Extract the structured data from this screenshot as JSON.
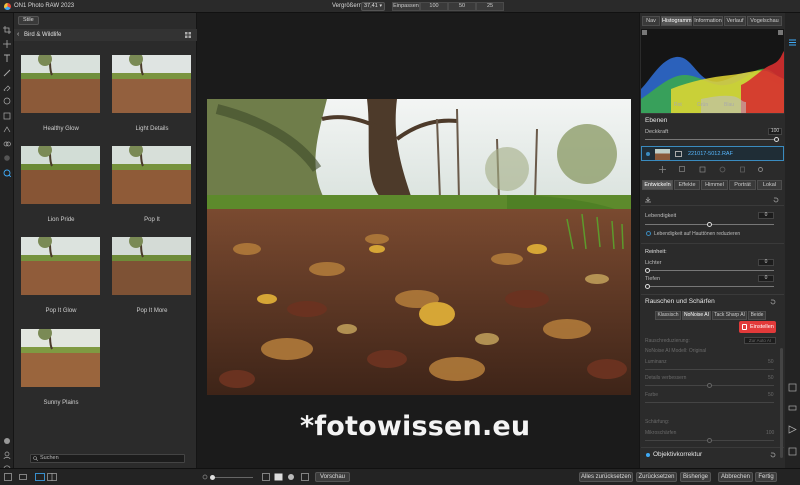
{
  "app": {
    "title": "ON1 Photo RAW 2023"
  },
  "toolbar": {
    "zoom_label": "Vergrößern",
    "zoom_value": "37,41",
    "fit_label": "Einpassen",
    "zoom_100": "100",
    "zoom_50": "50",
    "zoom_25": "25"
  },
  "presets": {
    "tab_label": "Stile",
    "category": "Bird & Wildlife",
    "items": [
      {
        "label": "Healthy Glow"
      },
      {
        "label": "Light Details"
      },
      {
        "label": "Lion Pride"
      },
      {
        "label": "Pop It"
      },
      {
        "label": "Pop It Glow"
      },
      {
        "label": "Pop It More"
      },
      {
        "label": "Sunny Plains"
      }
    ],
    "search_placeholder": "Suchen"
  },
  "canvas": {
    "watermark": "*fotowissen.eu"
  },
  "right_panel": {
    "tabs": [
      "Nav",
      "Histogramm",
      "Information",
      "Verlauf",
      "Vogelschau"
    ],
    "active_tab": "Histogramm",
    "histogram_legend": {
      "red": "Rot",
      "green": "Grün",
      "blue": "Blau"
    },
    "layers_title": "Ebenen",
    "opacity_label": "Deckkraft",
    "opacity_value": "100",
    "layer_name": "221017-5012.RAF",
    "modules": [
      "Entwickeln",
      "Effekte",
      "Himmel",
      "Porträt",
      "Lokal"
    ],
    "active_module": "Entwickeln",
    "vibrance_label": "Lebendigkeit",
    "vibrance_value": "0",
    "skin_tone_label": "Lebendigkeit auf Hauttönen reduzieren",
    "purity_title": "Reinheit:",
    "lights_label": "Lichter",
    "lights_value": "0",
    "depths_label": "Tiefen",
    "depths_value": "0",
    "noise_title": "Rauschen und Schärfen",
    "noise_tabs": [
      "Klassisch",
      "NoNoise AI",
      "Tack Sharp AI",
      "Beide"
    ],
    "active_noise_tab": "NoNoise AI",
    "unlock_button": "Einstellen",
    "noise_reduction_label": "Rauschreduzierung:",
    "auto_label": "Zur Auto AI",
    "nonoise_mode": "NoNoise AI Modell: Original",
    "luminance_label": "Luminanz",
    "luminance_value": "50",
    "detail_label": "Details verbessern",
    "detail_value": "50",
    "color_label": "Farbe",
    "color_value": "50",
    "sharpen_label": "Schärfung:",
    "microsharpen_label": "Mikroschärfen",
    "microsharpen_value": "100",
    "lens_title": "Objektivkorrektur"
  },
  "bottom": {
    "preview_button": "Vorschau",
    "reset_all_button": "Alles zurücksetzen",
    "reset_button": "Zurücksetzen",
    "previous_button": "Bisherige",
    "cancel_button": "Abbrechen",
    "done_button": "Fertig"
  },
  "colors": {
    "accent_blue": "#3a8bbf",
    "unlock_red": "#e23a3a",
    "panel_bg": "#2b2b2b"
  }
}
